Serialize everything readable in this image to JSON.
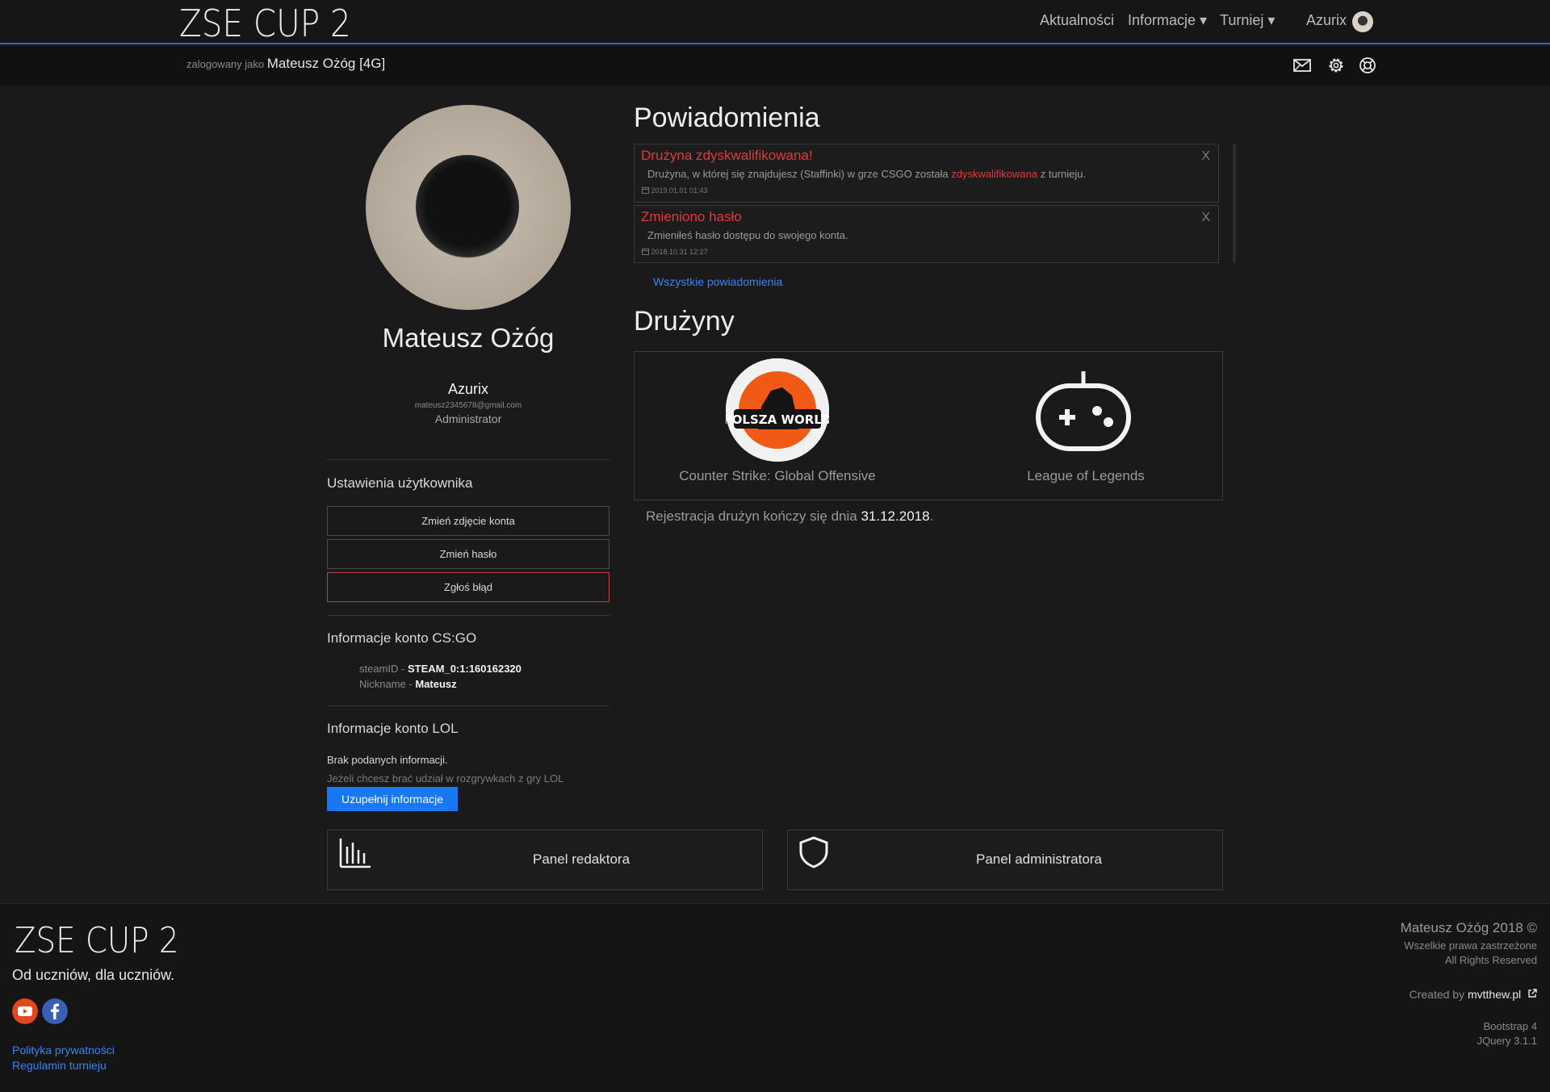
{
  "nav": {
    "brand": "ZSE CUP 2",
    "links": [
      "Aktualności",
      "Informacje ▾",
      "Turniej ▾"
    ],
    "user": "Azurix"
  },
  "subbar": {
    "logged_prefix": "zalogowany jako",
    "logged_user": "Mateusz Ożóg [4G]",
    "icons": [
      "mail-icon",
      "gear-icon",
      "lifebuoy-icon"
    ]
  },
  "profile": {
    "name": "Mateusz Ożóg",
    "nick": "Azurix",
    "email": "mateusz2345678@gmail.com",
    "role": "Administrator"
  },
  "settings": {
    "title": "Ustawienia użytkownika",
    "change_photo": "Zmień zdjęcie konta",
    "change_password": "Zmień hasło",
    "report_bug": "Zgłoś błąd"
  },
  "csgo": {
    "title": "Informacje konto CS:GO",
    "steamid_label": "steamID - ",
    "steamid": "STEAM_0:1:160162320",
    "nickname_label": "Nickname - ",
    "nickname": "Mateusz"
  },
  "lol": {
    "title": "Informacje konto LOL",
    "none": "Brak podanych informacji.",
    "hint": "Jeżeli chcesz brać udział w rozgrywkach z gry LOL",
    "button": "Uzupełnij informacje"
  },
  "notifications": {
    "title": "Powiadomienia",
    "items": [
      {
        "title": "Drużyna zdyskwalifikowana!",
        "body_pre": "Drużyna, w której się znajdujesz (Staffinki) w grze CSGO została ",
        "body_red": "zdyskwalifikowana",
        "body_post": " z turnieju.",
        "date": "2019.01.01 01:43",
        "close": "X"
      },
      {
        "title": "Zmieniono hasło",
        "body_pre": "Zmieniłeś hasło dostępu do swojego konta.",
        "body_red": "",
        "body_post": "",
        "date": "2018.10.31 12:27",
        "close": "X"
      }
    ],
    "all_link": "Wszystkie powiadomienia"
  },
  "teams": {
    "title": "Drużyny",
    "cards": [
      {
        "logo_text": "POLSZA WORLD",
        "game": "Counter Strike: Global Offensive"
      },
      {
        "logo_text": "",
        "game": "League of Legends"
      }
    ],
    "reg_text": "Rejestracja drużyn kończy się dnia ",
    "reg_date": "31.12.2018",
    "reg_dot": "."
  },
  "panels": {
    "editor": "Panel redaktora",
    "admin": "Panel administratora"
  },
  "footer": {
    "brand": "ZSE CUP 2",
    "tagline": "Od uczniów, dla uczniów.",
    "privacy": "Polityka prywatności",
    "rules": "Regulamin turnieju",
    "copyright": "Mateusz Ożóg 2018 ©",
    "rights_pl": "Wszelkie prawa zastrzeżone",
    "rights_en": "All Rights Reserved",
    "created_by_label": "Created by ",
    "created_by": "mvtthew.pl",
    "tech1": "Bootstrap 4",
    "tech2": "JQuery 3.1.1"
  },
  "colors": {
    "accent_blue": "#1877f2",
    "alert_red": "#e03a3a",
    "nav_underline": "#3461c8"
  }
}
